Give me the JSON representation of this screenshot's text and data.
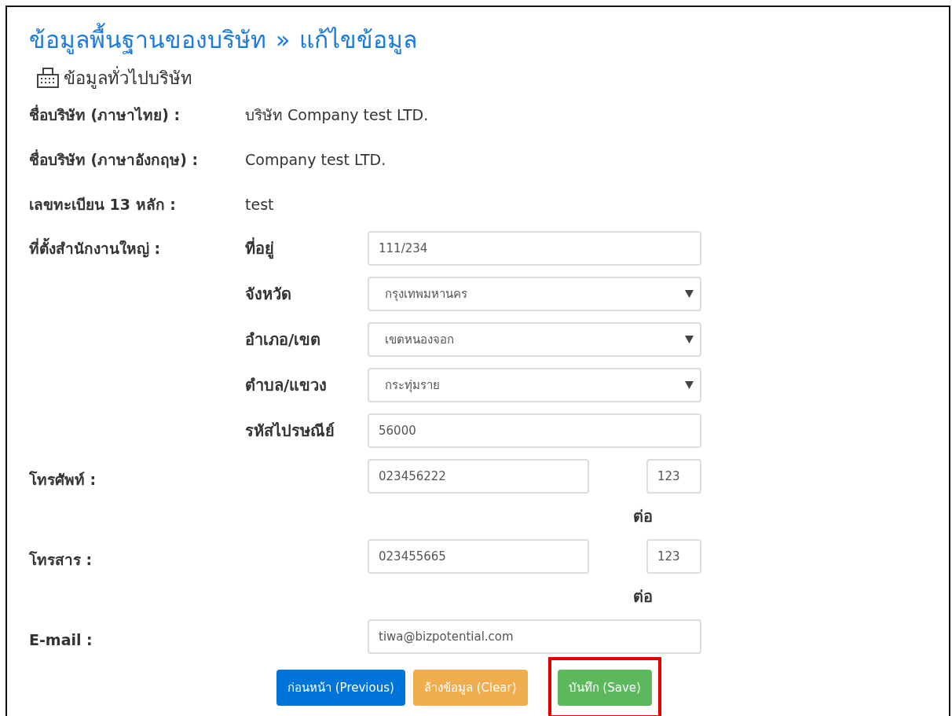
{
  "title": "ข้อมูลพื้นฐานของบริษัท",
  "title_separator": "»",
  "title_current": "แก้ไขข้อมูล",
  "section": {
    "title": "ข้อมูลทั่วไปบริษัท"
  },
  "info_rows": [
    {
      "label": "ชื่อบริษัท (ภาษาไทย) :",
      "value": "บริษัท Company test LTD."
    },
    {
      "label": "ชื่อบริษัท (ภาษาอังกฤษ) :",
      "value": "Company test LTD."
    },
    {
      "label": "เลขทะเบียน 13 หลัก :",
      "value": "test"
    }
  ],
  "address": {
    "label": "ที่ตั้งสำนักงานใหญ่ :",
    "fields": [
      {
        "label": "ที่อยู่",
        "kind": "text",
        "value": "111/234"
      },
      {
        "label": "จังหวัด",
        "kind": "select",
        "value": "กรุงเทพมหานคร"
      },
      {
        "label": "อำเภอ/เขต",
        "kind": "select",
        "value": "เขตหนองจอก"
      },
      {
        "label": "ตำบล/แขวง",
        "kind": "select",
        "value": "กระทุ่มราย"
      },
      {
        "label": "รหัสไปรษณีย์",
        "kind": "text",
        "value": "56000"
      }
    ]
  },
  "contacts": [
    {
      "label": "โทรศัพท์ :",
      "number": "023456222",
      "ext_label": "ต่อ",
      "ext": "123"
    },
    {
      "label": "โทรสาร :",
      "number": "023455665",
      "ext_label": "ต่อ",
      "ext": "123"
    }
  ],
  "email": {
    "label": "E-mail :",
    "value": "tiwa@bizpotential.com"
  },
  "buttons": [
    {
      "label": "ก่อนหน้า (Previous)",
      "kind": "primary",
      "highlighted": false
    },
    {
      "label": "ล้างข้อมูล (Clear)",
      "kind": "warning",
      "highlighted": false
    },
    {
      "label": "บันทึก (Save)",
      "kind": "success",
      "highlighted": true
    }
  ]
}
